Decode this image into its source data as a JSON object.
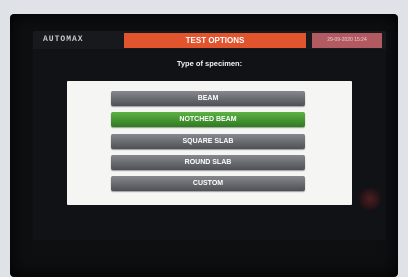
{
  "header": {
    "brand": "AUTOMAX",
    "title": "TEST OPTIONS",
    "datetime": "29-09-2020  15:24"
  },
  "prompt": "Type of specimen:",
  "options": [
    {
      "label": "BEAM",
      "selected": false
    },
    {
      "label": "NOTCHED BEAM",
      "selected": true
    },
    {
      "label": "SQUARE SLAB",
      "selected": false
    },
    {
      "label": "ROUND SLAB",
      "selected": false
    },
    {
      "label": "CUSTOM",
      "selected": false
    }
  ],
  "colors": {
    "title_bar": "#e2542e",
    "selected_option": "#4a9a38",
    "option": "#6a6c72",
    "panel": "#f5f5f3"
  }
}
